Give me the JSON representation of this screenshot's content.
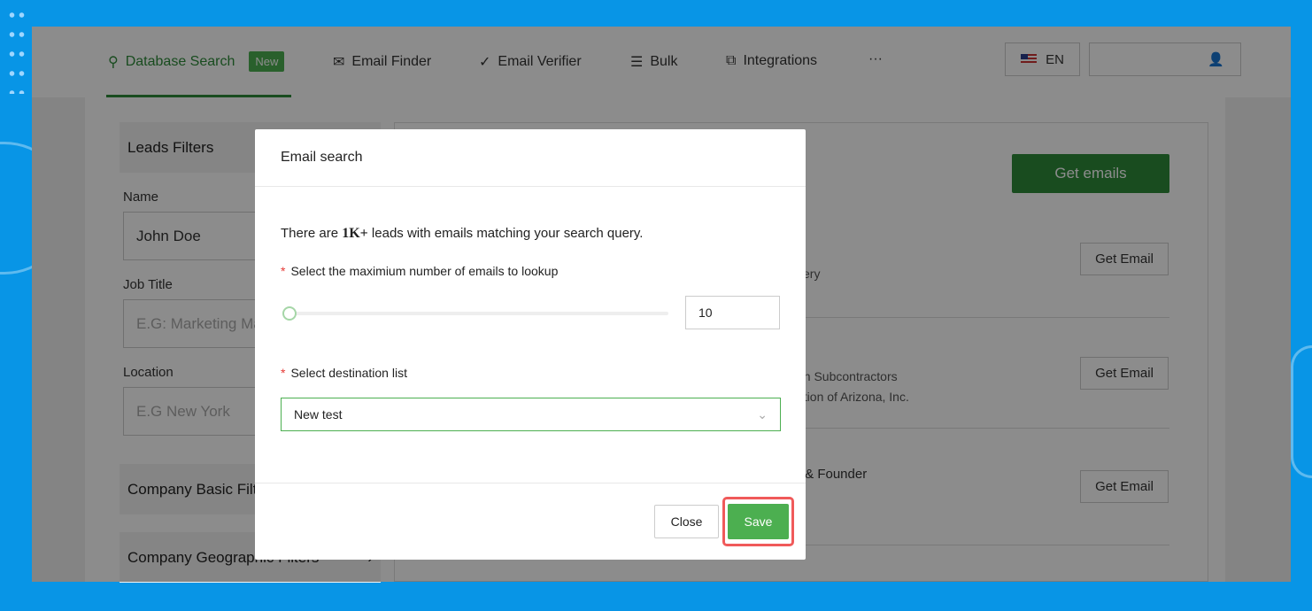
{
  "nav": {
    "tabs": [
      {
        "label": "Database Search",
        "badge": "New"
      },
      {
        "label": "Email Finder"
      },
      {
        "label": "Email Verifier"
      },
      {
        "label": "Bulk"
      },
      {
        "label": "Integrations"
      },
      {
        "label": "···"
      }
    ],
    "language": "EN"
  },
  "filters": {
    "title": "Leads Filters",
    "name_label": "Name",
    "name_value": "John Doe",
    "job_label": "Job Title",
    "job_placeholder": "E.G: Marketing Ma",
    "location_label": "Location",
    "location_placeholder": "E.G New York",
    "company_basic": "Company Basic Filte",
    "company_geo": "Company Geographic Filters"
  },
  "results": {
    "get_emails": "Get emails",
    "get_email": "Get Email",
    "snippets": [
      "kery",
      "an Subcontractors",
      "ation of Arizona, Inc.",
      "r & Founder"
    ]
  },
  "modal": {
    "title": "Email search",
    "text_pre": "There are ",
    "count": "1K+",
    "text_post": " leads with emails matching your search query.",
    "max_label": "Select the maximium number of emails to lookup",
    "max_value": "10",
    "slider_fraction": 0.0,
    "dest_label": "Select destination list",
    "dest_value": "New test",
    "close": "Close",
    "save": "Save"
  }
}
